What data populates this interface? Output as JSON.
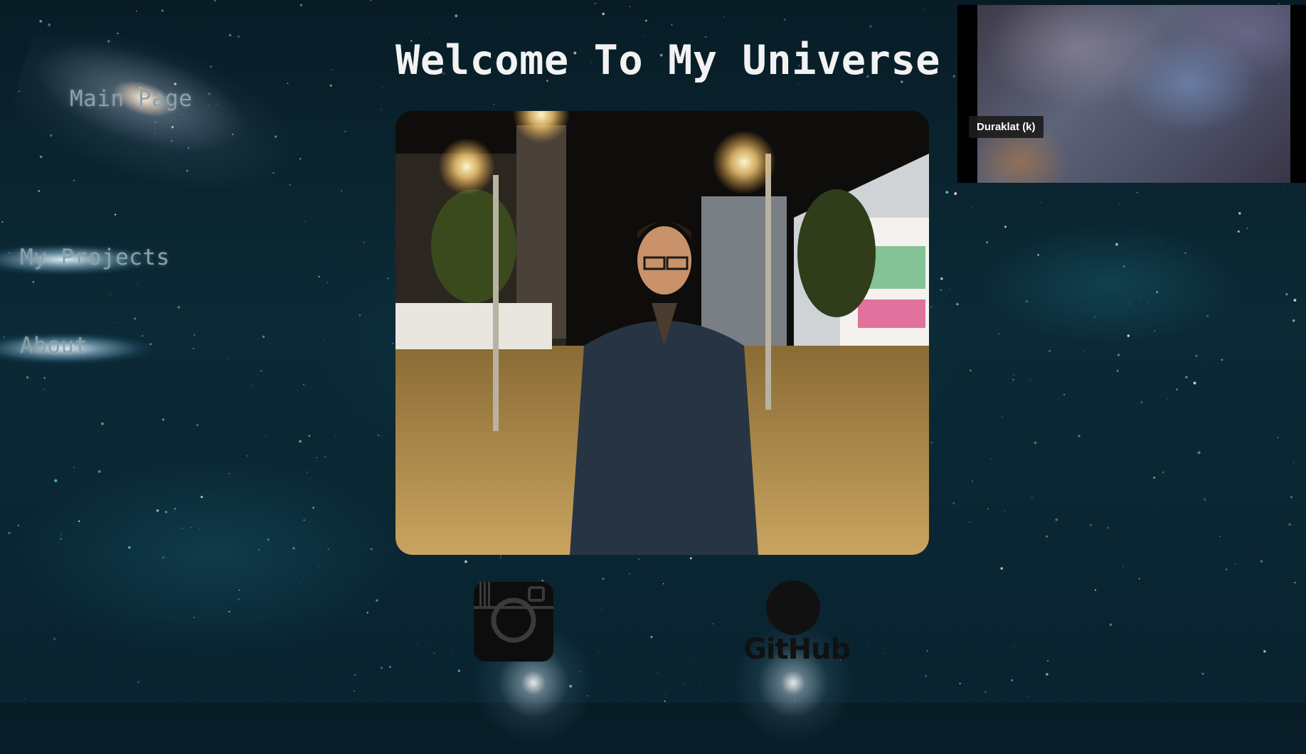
{
  "page": {
    "title": "Welcome To My Universe"
  },
  "nav": {
    "items": [
      {
        "label": "Main Page"
      },
      {
        "label": "My Projects"
      },
      {
        "label": "About"
      }
    ]
  },
  "profile_photo": {
    "icon": "portrait-photo"
  },
  "video_player": {
    "tooltip": "Duraklat (k)"
  },
  "social": {
    "instagram_icon": "instagram-icon",
    "github_label": "GitHub"
  },
  "colors": {
    "background": "#0b2a36",
    "title": "#f2f2f2",
    "nav_text": "#8aa1a8"
  }
}
